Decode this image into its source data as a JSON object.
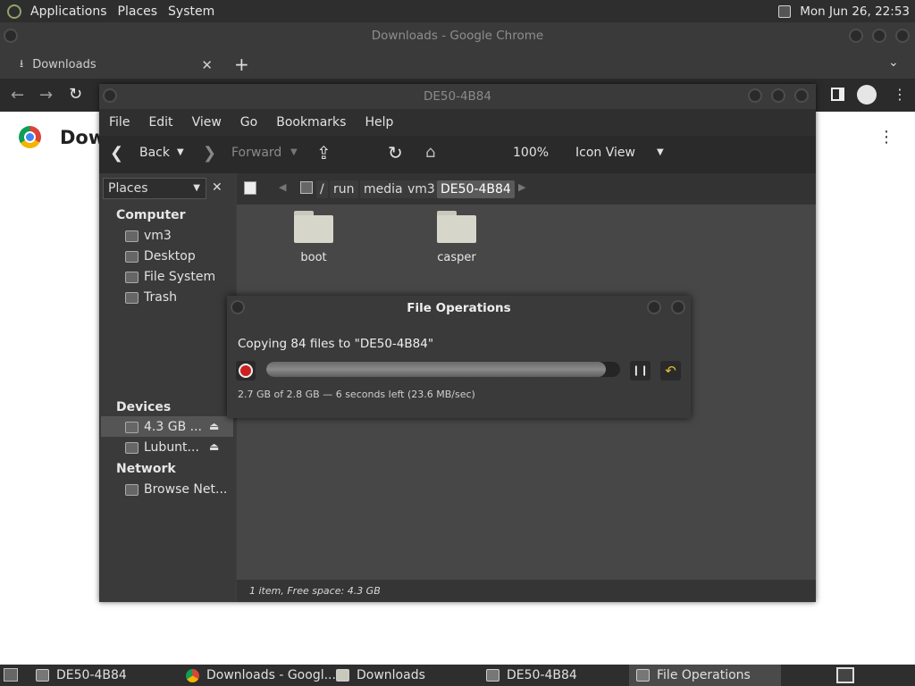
{
  "top_panel": {
    "menus": [
      "Applications",
      "Places",
      "System"
    ],
    "clock": "Mon Jun 26, 22:53"
  },
  "chrome": {
    "window_title": "Downloads - Google Chrome",
    "tab_title": "Downloads",
    "page_heading": "Dow"
  },
  "file_manager": {
    "window_title": "DE50-4B84",
    "menus": [
      "File",
      "Edit",
      "View",
      "Go",
      "Bookmarks",
      "Help"
    ],
    "toolbar": {
      "back": "Back",
      "forward": "Forward",
      "zoom": "100%",
      "view_mode": "Icon View"
    },
    "path": [
      "/",
      "run",
      "media",
      "vm3",
      "DE50-4B84"
    ],
    "sidebar": {
      "combo": "Places",
      "sections": [
        {
          "title": "Computer",
          "items": [
            "vm3",
            "Desktop",
            "File System",
            "Trash"
          ]
        },
        {
          "title": "Devices",
          "items": [
            "4.3 GB ...",
            "Lubunt..."
          ]
        },
        {
          "title": "Network",
          "items": [
            "Browse Net..."
          ]
        }
      ]
    },
    "files": [
      "boot",
      "casper"
    ],
    "status": "1 item, Free space: 4.3 GB"
  },
  "file_operations": {
    "title": "File Operations",
    "message": "Copying 84 files to \"DE50-4B84\"",
    "progress": 0.96,
    "detail": "2.7 GB of 2.8 GB — 6 seconds left (23.6 MB/sec)"
  },
  "taskbar": {
    "tasks": [
      "DE50-4B84",
      "Downloads - Googl...",
      "Downloads",
      "DE50-4B84",
      "File Operations"
    ]
  },
  "colors": {
    "stop_red": "#cc1f1f",
    "undo_yellow": "#e0c23a",
    "chrome_bg": "#3a3a3a"
  }
}
